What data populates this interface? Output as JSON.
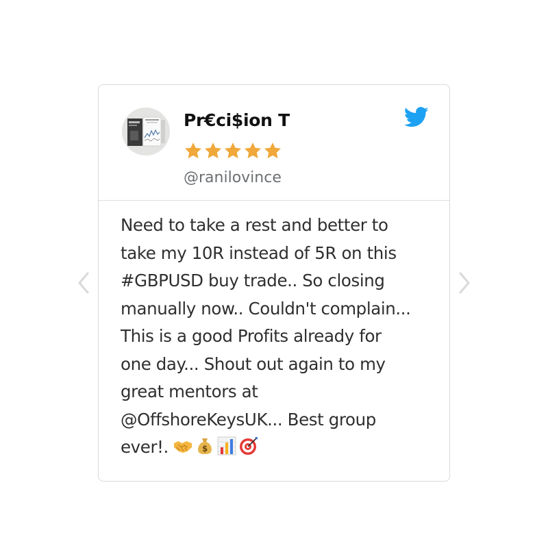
{
  "testimonial": {
    "author_name": "Pr€ci$ion T",
    "rating": 5,
    "handle": "@ranilovince",
    "lines": [
      "Need to take a rest and better to",
      "take my 10R instead of 5R on this",
      "#GBPUSD buy trade.. So closing",
      "manually now.. Couldn't complain...",
      "This is a good Profits already for",
      "one day... Shout out again to my",
      "great mentors at",
      "@OffshoreKeysUK... Best group",
      "ever!."
    ],
    "emojis": [
      "handshake-icon",
      "money-bag-icon",
      "bar-chart-icon",
      "target-icon"
    ]
  },
  "colors": {
    "star": "#f0a83a",
    "twitter_blue": "#1da1f2",
    "arrow": "#d9d9d9"
  },
  "icons": {
    "brand": "twitter-bird-icon",
    "prev": "chevron-left-icon",
    "next": "chevron-right-icon"
  }
}
